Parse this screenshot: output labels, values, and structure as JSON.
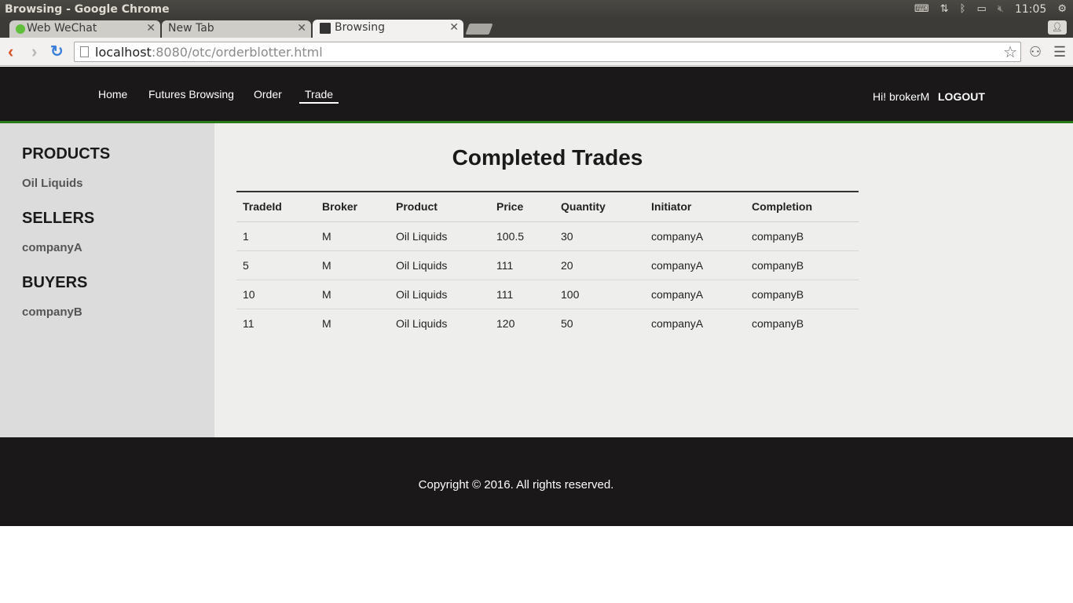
{
  "os": {
    "window_title": "Browsing - Google Chrome",
    "clock": "11:05"
  },
  "browser": {
    "tabs": [
      {
        "label": "Web WeChat",
        "active": false
      },
      {
        "label": "New Tab",
        "active": false
      },
      {
        "label": "Browsing",
        "active": true
      }
    ],
    "url_host": "localhost",
    "url_rest": ":8080/otc/orderblotter.html"
  },
  "header": {
    "nav": [
      "Home",
      "Futures Browsing",
      "Order",
      "Trade"
    ],
    "active_nav": "Trade",
    "greeting": "Hi! brokerM",
    "logout_label": "LOGOUT"
  },
  "sidebar": {
    "sections": [
      {
        "heading": "PRODUCTS",
        "items": [
          "Oil Liquids"
        ]
      },
      {
        "heading": "SELLERS",
        "items": [
          "companyA"
        ]
      },
      {
        "heading": "BUYERS",
        "items": [
          "companyB"
        ]
      }
    ]
  },
  "main": {
    "title": "Completed Trades",
    "columns": [
      "TradeId",
      "Broker",
      "Product",
      "Price",
      "Quantity",
      "Initiator",
      "Completion"
    ],
    "rows": [
      [
        "1",
        "M",
        "Oil Liquids",
        "100.5",
        "30",
        "companyA",
        "companyB"
      ],
      [
        "5",
        "M",
        "Oil Liquids",
        "111",
        "20",
        "companyA",
        "companyB"
      ],
      [
        "10",
        "M",
        "Oil Liquids",
        "111",
        "100",
        "companyA",
        "companyB"
      ],
      [
        "11",
        "M",
        "Oil Liquids",
        "120",
        "50",
        "companyA",
        "companyB"
      ]
    ]
  },
  "footer": {
    "copyright": "Copyright © 2016. All rights reserved."
  },
  "colors": {
    "header_bg": "#1a1819",
    "accent_green": "#2a7a1a",
    "sidebar_bg": "#dcdcdc",
    "main_bg": "#eeeeec"
  }
}
